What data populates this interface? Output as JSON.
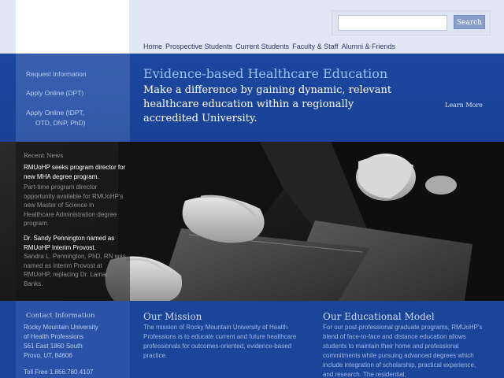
{
  "header": {
    "search_button": "Search",
    "search_value": "",
    "nav": [
      "Home",
      "Prospective Students",
      "Current Students",
      "Faculty & Staff",
      "Alumni & Friends"
    ]
  },
  "sidebar": {
    "request_info": "Request Information",
    "apply_dpt": "Apply Online (DPT)",
    "apply_other_1": "Apply Online (tDPT,",
    "apply_other_2": "OTD, DNP, PhD)"
  },
  "hero": {
    "title": "Evidence-based Healthcare Education",
    "text": "Make a difference by gaining dynamic, relevant healthcare education within a regionally accredited University.",
    "learn_more": "Learn More"
  },
  "news": {
    "heading": "Recent News",
    "items": [
      {
        "title": "RMUoHP seeks program director for new MHA degree program.",
        "body": "Part-time program director opportunity available for RMUoHP's new Master of Science in Healthcare Administration degree program."
      },
      {
        "title": "Dr. Sandy Pennington named as RMUoHP Interim Provost.",
        "body": "Sandra L. Pennington, PhD, RN was named as interim Provost at RMUoHP, replacing Dr. Lamar Banks."
      }
    ]
  },
  "contact": {
    "heading": "Contact Information",
    "lines": [
      "Rocky Mountain University",
      "of Health Professions",
      "561 East 1860 South",
      "Provo, UT, 84606",
      "Toll Free 1.866.780.4107"
    ]
  },
  "mission": {
    "title": "Our Mission",
    "body": "The mission of Rocky Mountain University of Health Professions is to educate current and future healthcare professionals for outcomes-oriented, evidence-based practice."
  },
  "model": {
    "title": "Our Educational Model",
    "body": "For our post-professional graduate programs, RMUoHP's blend of face-to-face and distance education allows students to maintain their home and professional commitments while pursuing advanced degrees which include integration of scholarship, practical experience, and research. The residential,"
  },
  "colors": {
    "top_band": "#e2e7f6",
    "hero_band": "#1c479e",
    "sidebar": "#3a5fb0",
    "bottom_band": "#1c4498",
    "accent_link": "#b8cef5"
  },
  "icons": [
    "photo-hands-folders"
  ]
}
